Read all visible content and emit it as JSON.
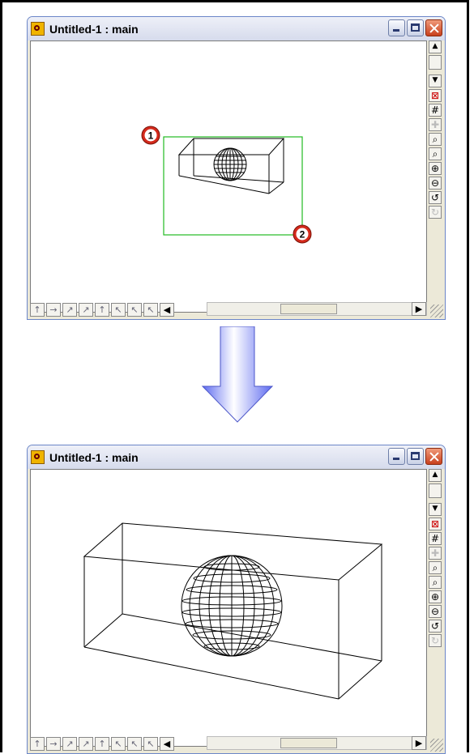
{
  "windows": [
    {
      "title": "Untitled-1 : main"
    },
    {
      "title": "Untitled-1 : main"
    }
  ],
  "markers": {
    "first": "1",
    "second": "2"
  },
  "icons": {
    "app": "app-icon",
    "minimize": "minimize-icon",
    "maximize": "maximize-icon",
    "close": "close-icon",
    "arrow": "down-arrow-icon"
  },
  "colors": {
    "selection": "#22bb22",
    "arrow": "#7b86ee",
    "marker": "#d42a1c"
  }
}
